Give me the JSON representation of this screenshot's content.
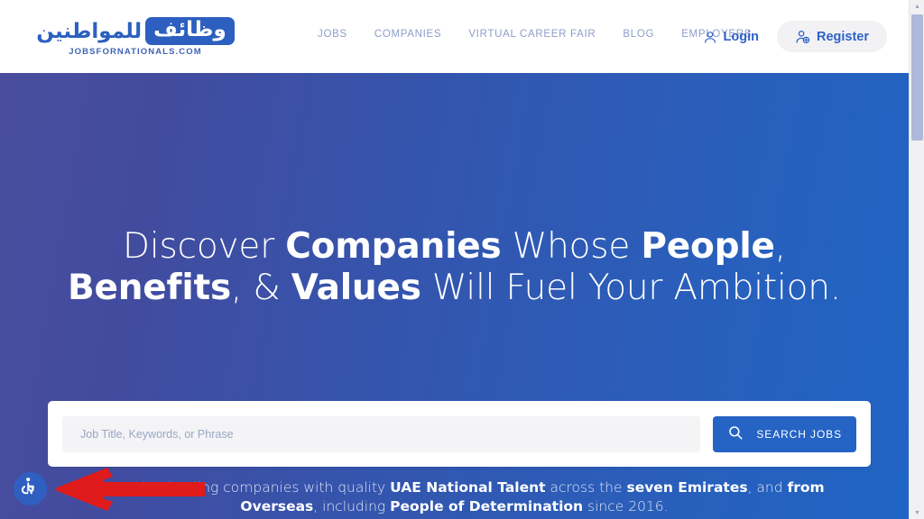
{
  "header": {
    "logo": {
      "badge_text": "وظائف",
      "word_text": "للمواطنين",
      "tagline": "JOBSFORNATIONALS.COM"
    },
    "nav": [
      {
        "label": "JOBS"
      },
      {
        "label": "COMPANIES"
      },
      {
        "label": "VIRTUAL CAREER FAIR"
      },
      {
        "label": "BLOG"
      },
      {
        "label": "EMPLOYERS"
      }
    ],
    "auth": {
      "login_label": "Login",
      "register_label": "Register"
    }
  },
  "hero": {
    "headline": {
      "part1": "Discover ",
      "bold1": "Companies",
      "part2": " Whose ",
      "bold2": "People",
      "part3": ",",
      "bold3": "Benefits",
      "part4": ", & ",
      "bold4": "Values",
      "part5": " Will Fuel Your Ambition."
    },
    "search": {
      "placeholder": "Job Title, Keywords, or Phrase",
      "value": "",
      "button_label": "SEARCH JOBS"
    },
    "subtitle": {
      "part1": "Connecting leading companies with quality ",
      "bold1": "UAE National Talent",
      "part2": " across the ",
      "bold2": "seven Emirates",
      "part3": ", and ",
      "bold3": "from Overseas",
      "part4": ", including ",
      "bold4": "People of Determination",
      "part5": " since 2016."
    }
  },
  "widgets": {
    "accessibility_label": "Accessibility",
    "annotation_arrow": "red-left-arrow"
  },
  "scrollbar": {
    "up_glyph": "▲",
    "down_glyph": "▼"
  },
  "colors": {
    "brand_blue": "#2563c5",
    "hero_gradient_start": "#4a4d9e",
    "hero_gradient_end": "#2064c4",
    "nav_text": "#8e9cc8",
    "annotation_red": "#e01b1b"
  }
}
